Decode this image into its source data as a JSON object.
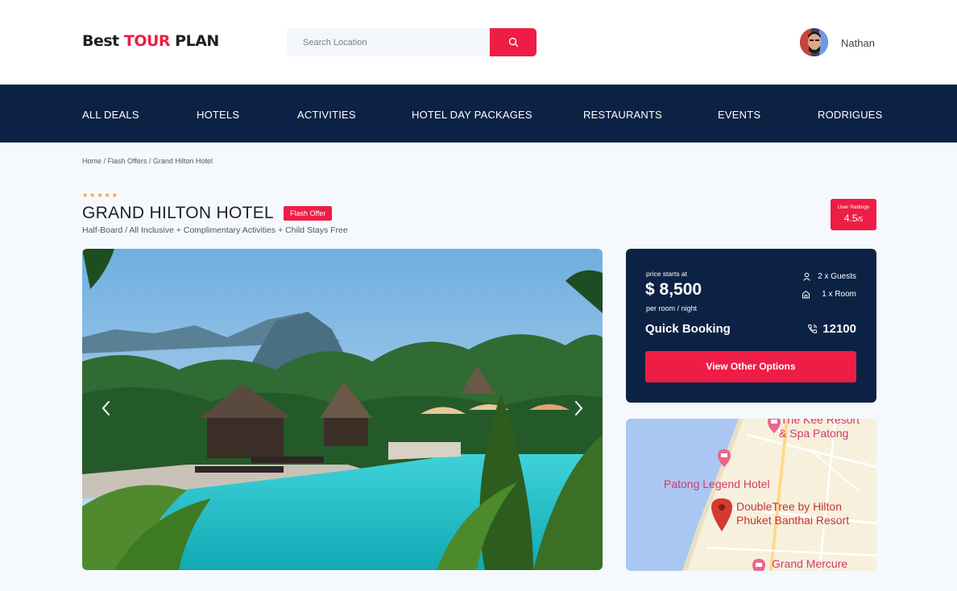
{
  "header": {
    "logo_part1": "Best ",
    "logo_part2": "TOUR",
    "logo_part3": " PLAN",
    "search_placeholder": "Search Location",
    "search_icon": "search-icon",
    "user_name": "Nathan"
  },
  "nav": {
    "items": [
      "ALL DEALS",
      "HOTELS",
      "ACTIVITIES",
      "HOTEL DAY PACKAGES",
      "RESTAURANTS",
      "EVENTS",
      "RODRIGUES"
    ]
  },
  "breadcrumb": [
    "Home",
    "Flash Offers",
    "Grand Hilton Hotel"
  ],
  "hotel": {
    "stars": 5,
    "star_glyphs": "★★★★★",
    "title": "GRAND HILTON HOTEL",
    "badge": "Flash Offer",
    "subtitle": "Half-Board / All Inclusive + Complimentary Activities + Child Stays Free"
  },
  "rating": {
    "label": "User Rattings",
    "value": "4.5",
    "scale": "/5"
  },
  "booking": {
    "price_label": "price starts at",
    "price": "$ 8,500",
    "per": "per room / night",
    "guests": "2 x Guests",
    "rooms": "1 x Room",
    "quick_label": "Quick Booking",
    "phone": "12100",
    "button": "View Other Options"
  },
  "map": {
    "labels": {
      "kee1": "The Kee Resort",
      "kee2": "& Spa Patong",
      "legend": "Patong Legend Hotel",
      "dt1": "DoubleTree by Hilton",
      "dt2": "Phuket Banthai Resort",
      "mercure": "Grand Mercure"
    }
  },
  "colors": {
    "accent": "#ee1d45",
    "navy": "#0c2244",
    "star": "#f39a3a",
    "background": "#f5f9fd"
  }
}
